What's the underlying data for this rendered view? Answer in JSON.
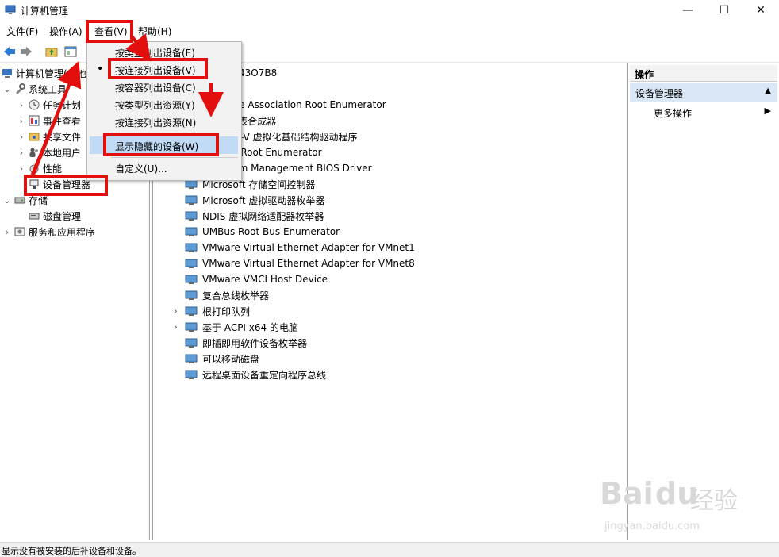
{
  "window": {
    "title": "计算机管理",
    "min": "—",
    "max": "☐",
    "close": "✕"
  },
  "menubar": {
    "file": "文件(F)",
    "action": "操作(A)",
    "view": "查看(V)",
    "help": "帮助(H)"
  },
  "tree": {
    "root": "计算机管理(本地",
    "system_tools": "系统工具",
    "task_scheduler": "任务计划",
    "event_viewer": "事件查看",
    "shared_folders": "共享文件",
    "local_users": "本地用户",
    "performance": "性能",
    "device_manager": "设备管理器",
    "storage": "存储",
    "disk_management": "磁盘管理",
    "services_apps": "服务和应用程序"
  },
  "center": {
    "computer_name_partial": "43O7B8",
    "devices": [
      "ft Device Association Root Enumerator",
      "ft GS 波表合成器",
      "ft Hyper-V 虚拟化基础结构驱动程序",
      "ft RRAS Root Enumerator",
      "ft System Management BIOS Driver",
      "Microsoft 存储空间控制器",
      "Microsoft 虚拟驱动器枚举器",
      "NDIS 虚拟网络适配器枚举器",
      "UMBus Root Bus Enumerator",
      "VMware Virtual Ethernet Adapter for VMnet1",
      "VMware Virtual Ethernet Adapter for VMnet8",
      "VMware VMCI Host Device",
      "复合总线枚举器",
      "根打印队列",
      "基于 ACPI x64 的电脑",
      "即插即用软件设备枚举器",
      "可以移动磁盘",
      "远程桌面设备重定向程序总线"
    ]
  },
  "view_menu": {
    "items": [
      "按类型列出设备(E)",
      "按连接列出设备(V)",
      "按容器列出设备(C)",
      "按类型列出资源(Y)",
      "按连接列出资源(N)",
      "显示隐藏的设备(W)",
      "自定义(U)..."
    ],
    "bullet": "•"
  },
  "actions": {
    "header": "操作",
    "section": "设备管理器",
    "more": "更多操作"
  },
  "status": {
    "text": "显示没有被安装的后补设备和设备。"
  },
  "watermark": {
    "brand": "Bai",
    "brand2": "du",
    "jingyan": "经验",
    "url": "jingyan.baidu.com"
  },
  "colors": {
    "highlight_red": "#e30e0e",
    "menu_highlight": "#c1daf5",
    "selection_blue": "#d9e7f6"
  }
}
